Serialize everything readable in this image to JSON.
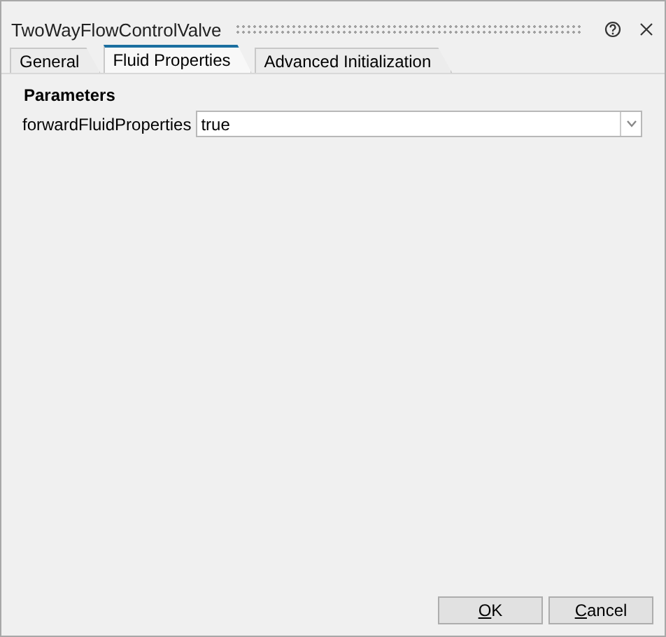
{
  "window": {
    "title": "TwoWayFlowControlValve"
  },
  "tabs": [
    {
      "label": "General",
      "selected": false
    },
    {
      "label": "Fluid Properties",
      "selected": true
    },
    {
      "label": "Advanced Initialization",
      "selected": false
    }
  ],
  "section": {
    "title": "Parameters"
  },
  "parameters": [
    {
      "name": "forwardFluidProperties",
      "value": "true"
    }
  ],
  "buttons": [
    "OK",
    "Cancel"
  ]
}
